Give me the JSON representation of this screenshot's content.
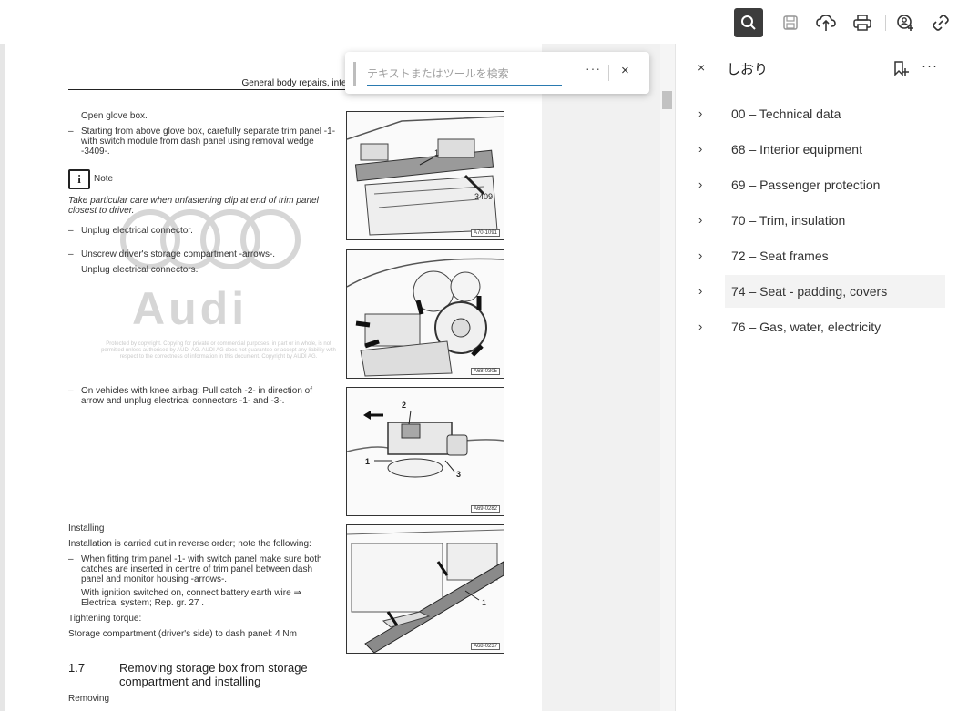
{
  "toolbar": {
    "icons": [
      "search-icon",
      "save-icon",
      "cloud-upload-icon",
      "print-icon",
      "share-icon",
      "link-icon"
    ]
  },
  "find": {
    "placeholder": "テキストまたはツールを検索",
    "more": "···",
    "close": "×"
  },
  "panel": {
    "title": "しおり",
    "close": "×",
    "more": "···",
    "items": [
      {
        "label": "00 – Technical data",
        "chevron": "›"
      },
      {
        "label": "68 – Interior equipment",
        "chevron": "›"
      },
      {
        "label": "69 – Passenger protection",
        "chevron": "›"
      },
      {
        "label": "70 – Trim, insulation",
        "chevron": "›"
      },
      {
        "label": "72 – Seat frames",
        "chevron": "›"
      },
      {
        "label": "74 – Seat - padding, covers",
        "chevron": "›"
      },
      {
        "label": "76 – Gas, water, electricity",
        "chevron": "›"
      }
    ]
  },
  "document": {
    "running_head": "General body repairs, interior",
    "step_open": "Open glove box.",
    "step_separate": "Starting from above glove box, carefully separate trim panel -1- with switch module from dash panel using removal wedge -3409-.",
    "note_label": "Note",
    "note_text": "Take particular care when unfastening clip at end of trim panel closest to driver.",
    "step_unplug": "Unplug electrical connector.",
    "step_unscrew": "Unscrew driver's storage compartment -arrows-.",
    "step_unplug2": "Unplug electrical connectors.",
    "watermark": "Audi",
    "copyright": "Protected by copyright. Copying for private or commercial purposes, in part or in whole, is not permitted unless authorised by AUDI AG. AUDI AG does not guarantee or accept any liability with respect to the correctness of information in this document. Copyright by AUDI AG.",
    "step_knee": "On vehicles with knee airbag: Pull catch -2- in direction of arrow and unplug electrical connectors -1- and -3-.",
    "installing": "Installing",
    "installing_text": "Installation is carried out in reverse order; note the following:",
    "step_fitting": "When fitting trim panel -1- with switch panel make sure both catches are inserted in centre of trim panel between dash panel and monitor housing -arrows-.",
    "step_ignition": "With ignition switched on, connect battery earth wire ⇒ Electrical system; Rep. gr. 27 .",
    "torque_label": "Tightening torque:",
    "torque_text": "Storage compartment (driver's side) to dash panel: 4 Nm",
    "section_num": "1.7",
    "section_title": "Removing storage box from storage compartment and installing",
    "removing": "Removing",
    "bullet": "–",
    "figures": [
      {
        "id": "A70-1091",
        "callouts": [
          "1",
          "3409"
        ]
      },
      {
        "id": "A68-0305"
      },
      {
        "id": "A69-0282",
        "callouts": [
          "2",
          "1",
          "3"
        ]
      },
      {
        "id": "A68-0237",
        "callouts": [
          "1"
        ]
      }
    ]
  }
}
